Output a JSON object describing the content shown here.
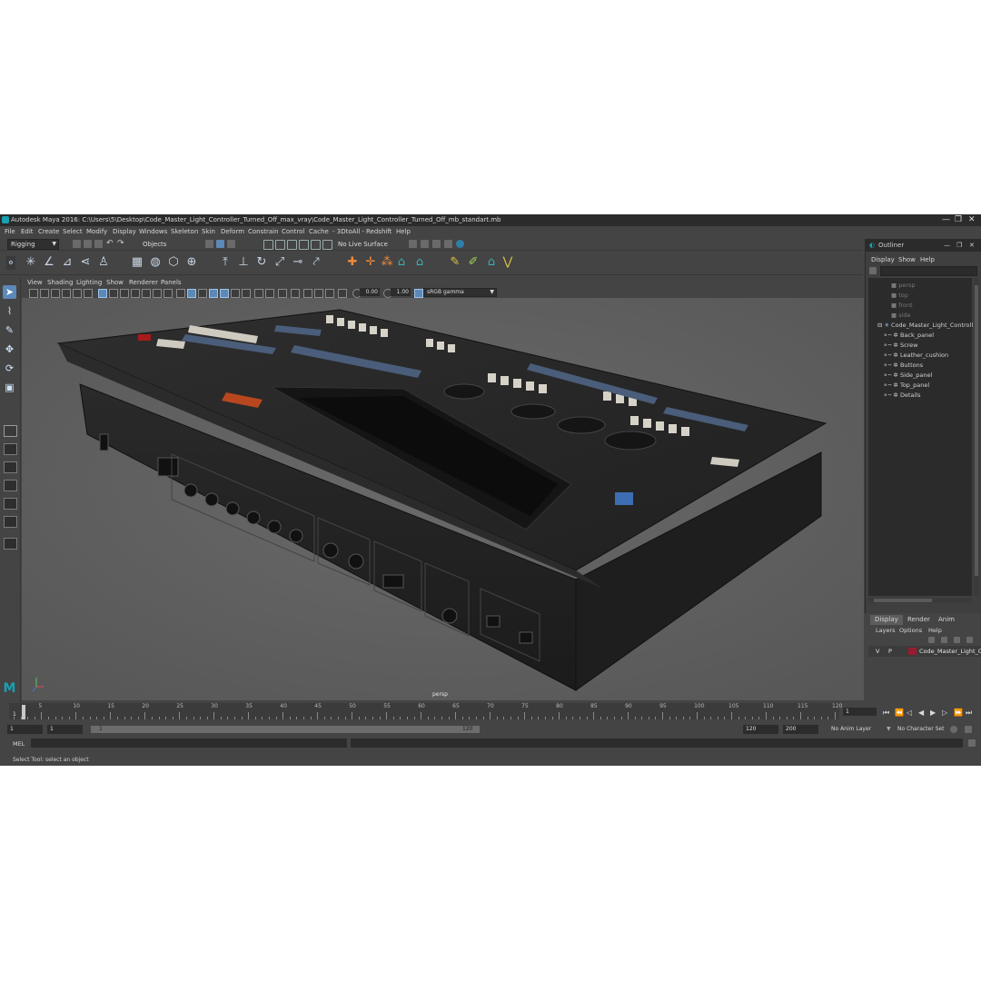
{
  "window": {
    "title": "Autodesk Maya 2016: C:\\Users\\5\\Desktop\\Code_Master_Light_Controller_Turned_Off_max_vray\\Code_Master_Light_Controller_Turned_Off_mb_standart.mb",
    "minimize": "—",
    "maximize": "❐",
    "close": "✕"
  },
  "menubar": [
    "File",
    "Edit",
    "Create",
    "Select",
    "Modify",
    "Display",
    "Windows",
    "Skeleton",
    "Skin",
    "Deform",
    "Constrain",
    "Control",
    "Cache",
    "- 3DtoAll -",
    "Redshift",
    "Help"
  ],
  "statusline": {
    "menuset": "Rigging",
    "selection_mode": "Objects",
    "live_surface": "No Live Surface"
  },
  "viewport_panel": {
    "menus": [
      "View",
      "Shading",
      "Lighting",
      "Show",
      "Renderer",
      "Panels"
    ],
    "exposure": "0.00",
    "gamma": "1.00",
    "color_space": "sRGB gamma",
    "camera_label": "persp"
  },
  "outliner": {
    "title": "Outliner",
    "menus": [
      "Display",
      "Show",
      "Help"
    ],
    "items": [
      {
        "label": "persp",
        "kind": "camera",
        "dim": true
      },
      {
        "label": "top",
        "kind": "camera",
        "dim": true
      },
      {
        "label": "front",
        "kind": "camera",
        "dim": true
      },
      {
        "label": "side",
        "kind": "camera",
        "dim": true
      },
      {
        "label": "Code_Master_Light_Controll",
        "kind": "group",
        "dim": false
      },
      {
        "label": "Back_panel",
        "kind": "mesh",
        "dim": false
      },
      {
        "label": "Screw",
        "kind": "mesh",
        "dim": false
      },
      {
        "label": "Leather_cushion",
        "kind": "mesh",
        "dim": false
      },
      {
        "label": "Buttons",
        "kind": "mesh",
        "dim": false
      },
      {
        "label": "Side_panel",
        "kind": "mesh",
        "dim": false
      },
      {
        "label": "Top_panel",
        "kind": "mesh",
        "dim": false
      },
      {
        "label": "Details",
        "kind": "mesh",
        "dim": false
      }
    ]
  },
  "layer_editor": {
    "tabs": [
      "Display",
      "Render",
      "Anim"
    ],
    "menus": [
      "Layers",
      "Options",
      "Help"
    ],
    "layer": {
      "visible": "V",
      "playback": "P",
      "name": "Code_Master_Light_Co",
      "color": "#9b1b2e"
    }
  },
  "timeline": {
    "ticks": [
      "5",
      "10",
      "15",
      "20",
      "25",
      "30",
      "35",
      "40",
      "45",
      "50",
      "55",
      "60",
      "65",
      "70",
      "75",
      "80",
      "85",
      "90",
      "95",
      "100",
      "105",
      "110",
      "115",
      "120"
    ],
    "current_frame_marker": "1",
    "current_frame_field": "1"
  },
  "range": {
    "start": "1",
    "playback_start": "1",
    "slider_start": "1",
    "slider_end": "120",
    "playback_end": "120",
    "end": "200",
    "anim_layer": "No Anim Layer",
    "character_set": "No Character Set"
  },
  "command_line": {
    "label": "MEL"
  },
  "help_line": "Select Tool: select an object"
}
